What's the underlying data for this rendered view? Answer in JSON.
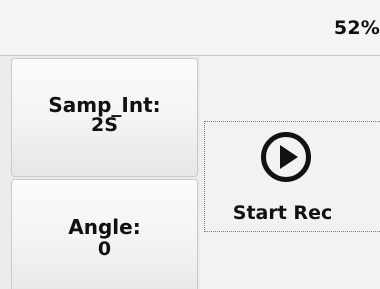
{
  "status_bar": {
    "battery_percent": "52%"
  },
  "params": {
    "sample_interval": {
      "label": "Samp_Int:",
      "value": "2S"
    },
    "angle": {
      "label": "Angle:",
      "value": "0"
    }
  },
  "record": {
    "label": "Start Rec",
    "icon": "play-circle-icon"
  },
  "colors": {
    "text": "#111111",
    "background": "#f2f2f2",
    "card_border": "#c9c9c9"
  }
}
